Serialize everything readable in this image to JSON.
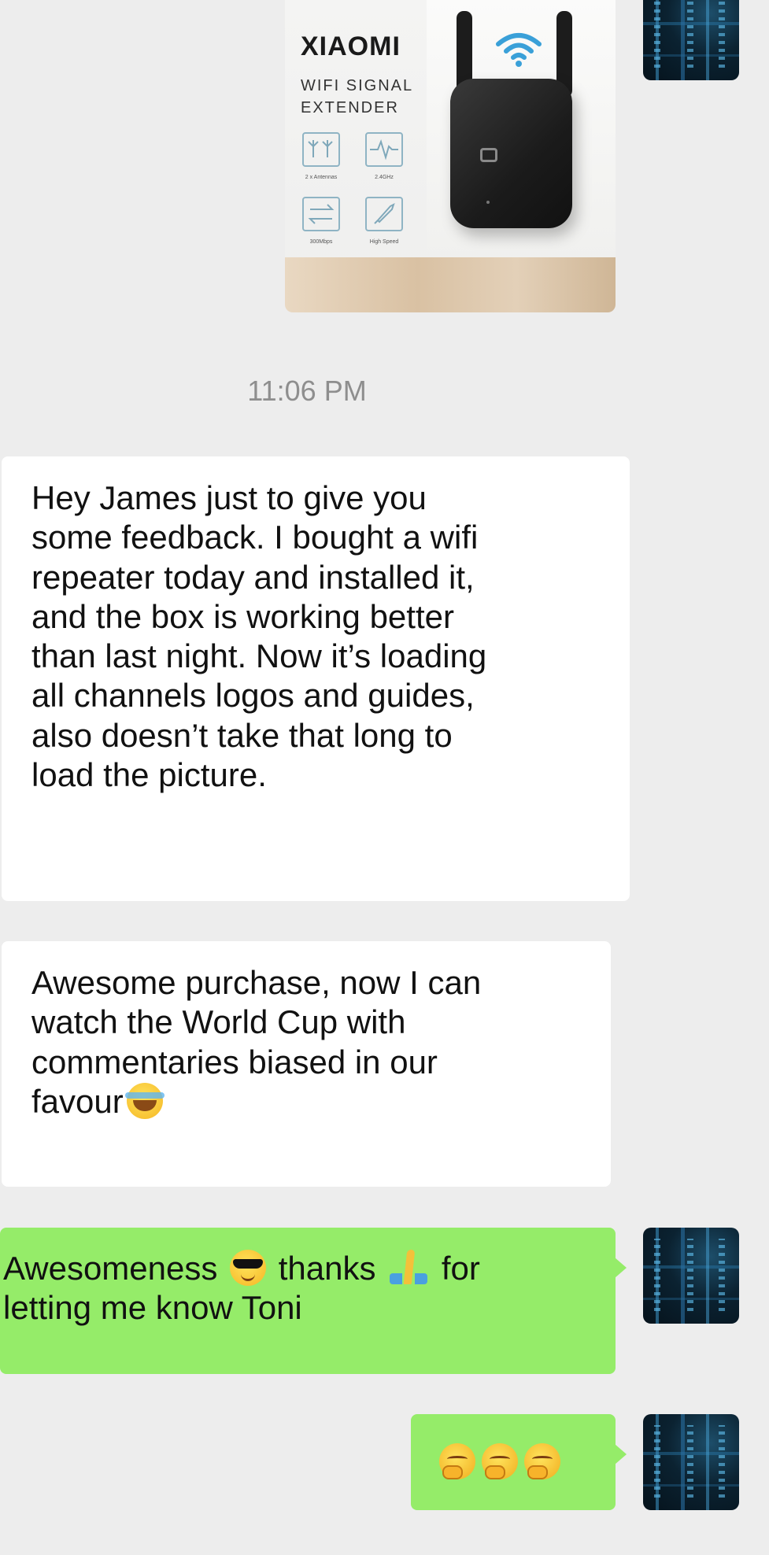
{
  "product_image": {
    "brand": "XIAOMI",
    "subtitle": "WIFI SIGNAL\nEXTENDER",
    "features": [
      "2 x Antennas",
      "2.4GHz",
      "300Mbps",
      "High Speed"
    ]
  },
  "timestamp": "11:06 PM",
  "messages": [
    {
      "text": "Hey James just to give you\nsome feedback. I bought a wifi\nrepeater today and installed it,\nand the box is working better\nthan last night. Now it’s loading\nall channels logos and guides,\nalso doesn’t take that long to\nload the picture."
    },
    {
      "text": "Awesome purchase, now I can\nwatch the World Cup with\ncommentaries biased in our\nfavour",
      "emoji": "face-with-tears-of-joy"
    },
    {
      "line1_a": "Awesomeness",
      "line1_b": "thanks",
      "line1_c": "for",
      "line2": "letting me know Toni",
      "emojis": [
        "smiling-face-with-sunglasses",
        "folded-hands"
      ]
    },
    {
      "emojis": [
        "thinking-face",
        "thinking-face",
        "thinking-face"
      ]
    }
  ],
  "colors": {
    "background": "#ededed",
    "incoming_bubble": "#ffffff",
    "outgoing_bubble": "#95ec69",
    "timestamp": "#8e8e8e"
  }
}
